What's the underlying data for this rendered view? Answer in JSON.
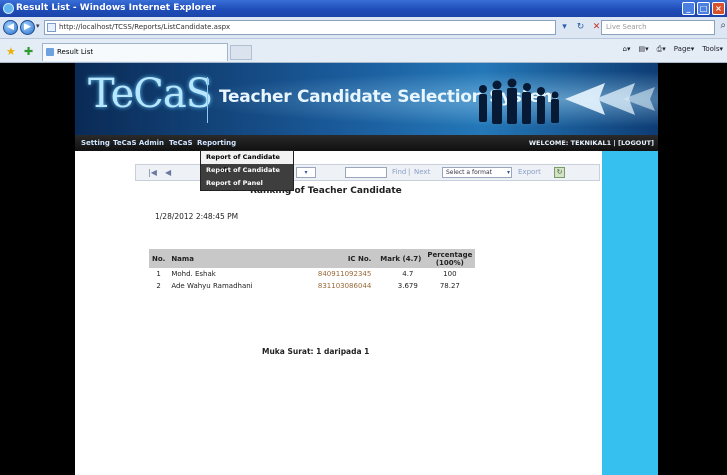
{
  "window": {
    "title": "Result List - Windows Internet Explorer",
    "url": "http://localhost/TCSS/Reports/ListCandidate.aspx",
    "search_placeholder": "Live Search",
    "tab_label": "Result List",
    "cmd_page": "Page",
    "cmd_tools": "Tools"
  },
  "banner": {
    "logo": "TeCaS",
    "system_title": "Teacher Candidate Selection System"
  },
  "menu": {
    "items": [
      "Setting",
      "TeCaS Admin",
      "TeCaS",
      "Reporting"
    ],
    "welcome": "WELCOME: TEKNIKAL1 | [LOGOUT]"
  },
  "dropdown": {
    "items": [
      "Report of Candidate Result",
      "Report of Candidate",
      "Report of Panel"
    ],
    "active_index": 0
  },
  "report_toolbar": {
    "first_icon": "|◀",
    "prev_icon": "◀",
    "find_label": "Find",
    "separator": "|",
    "next_label": "Next",
    "format_placeholder": "Select a format",
    "export_label": "Export"
  },
  "report": {
    "title": "Ranking of Teacher Candidate",
    "date": "1/28/2012 2:48:45 PM",
    "headers": {
      "no": "No.",
      "nama": "Nama",
      "ic": "IC No.",
      "mark": "Mark (4.7)",
      "percentage": "Percentage (100%)"
    },
    "rows": [
      {
        "no": "1",
        "nama": "Mohd. Eshak",
        "ic": "840911092345",
        "mark": "4.7",
        "percentage": "100"
      },
      {
        "no": "2",
        "nama": "Ade Wahyu Ramadhani",
        "ic": "831103086044",
        "mark": "3.679",
        "percentage": "78.27"
      }
    ],
    "footer": "Muka Surat: 1 daripada 1"
  }
}
